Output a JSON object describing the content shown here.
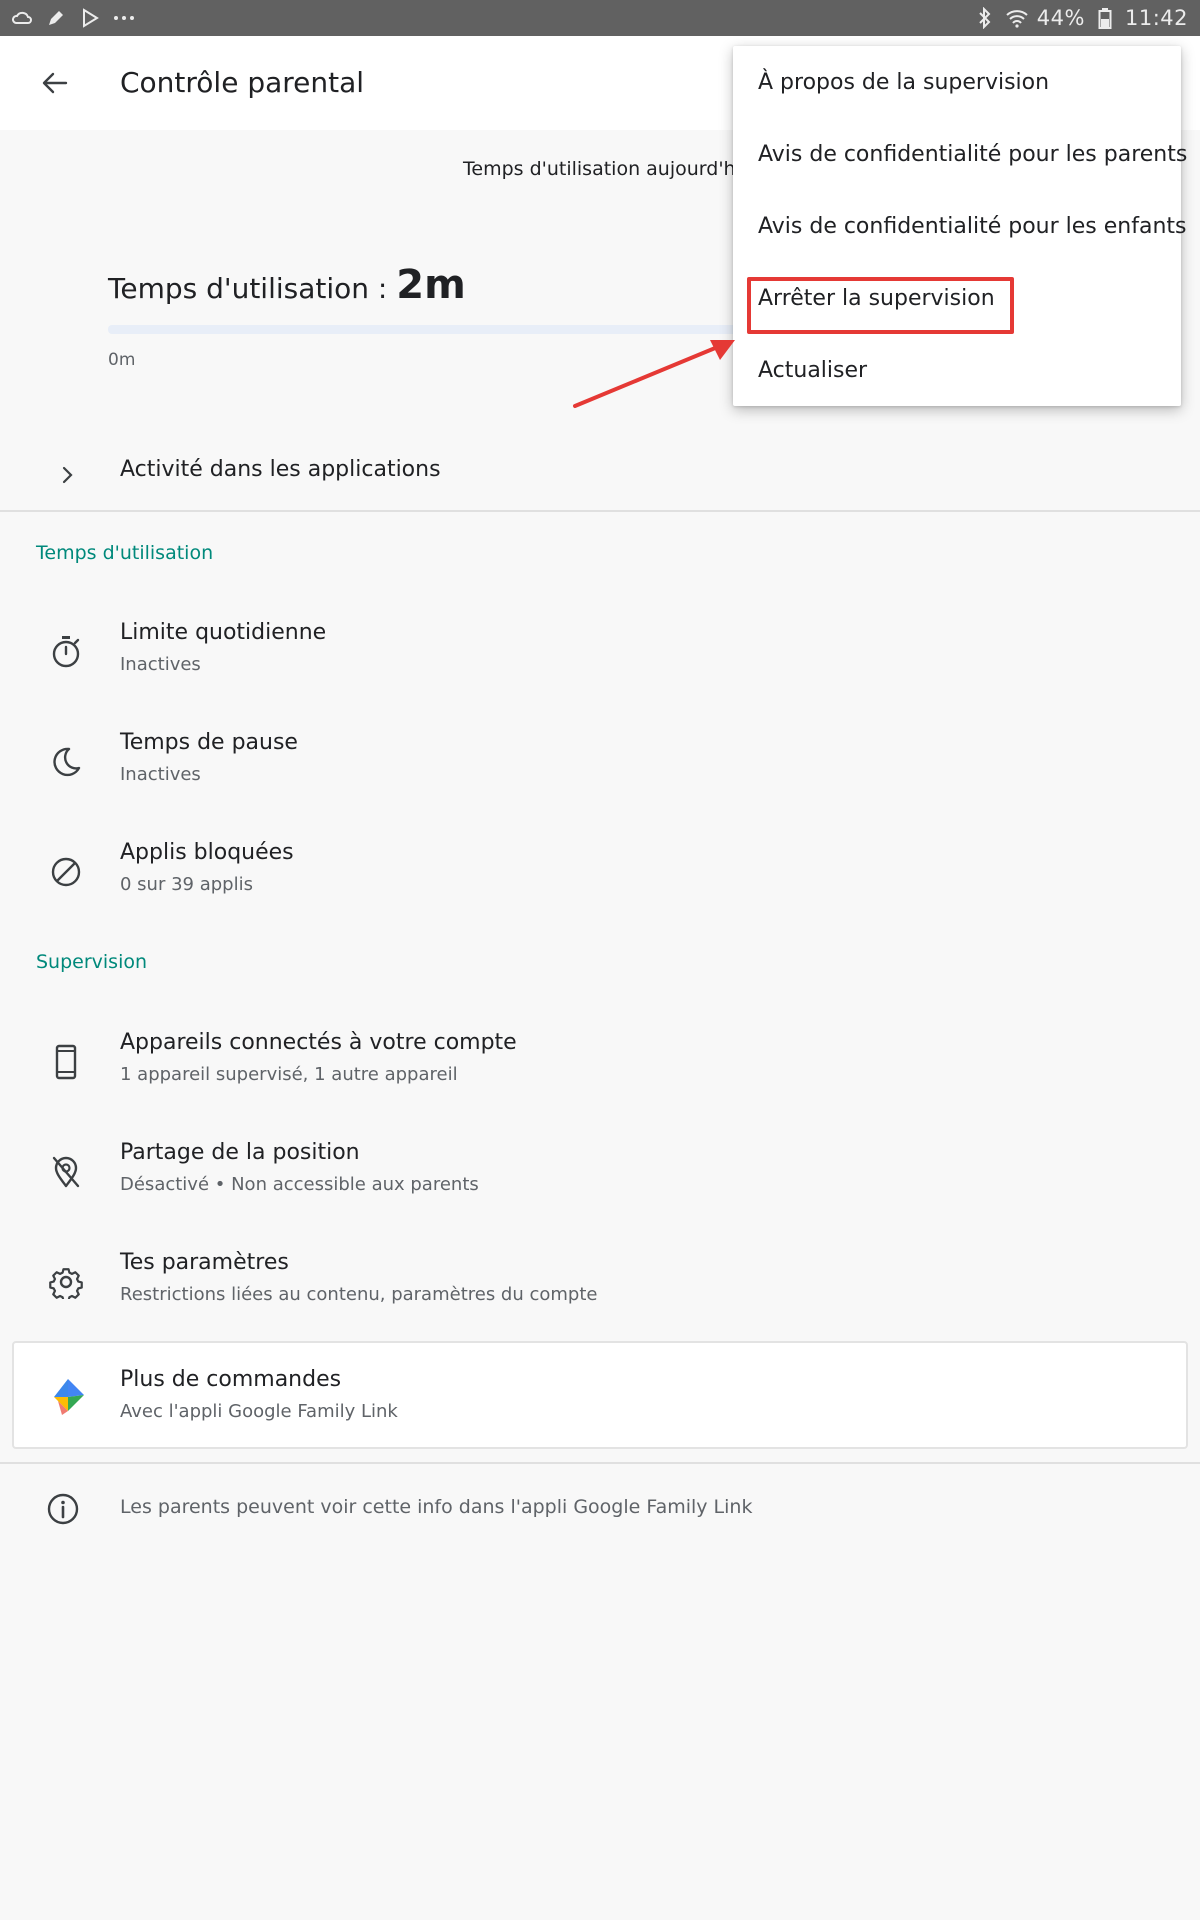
{
  "status_bar": {
    "left_icons": [
      "cloud-icon",
      "pen-icon",
      "play-store-icon",
      "more-dots-icon"
    ],
    "battery_percent": "44%",
    "time": "11:42"
  },
  "app_bar": {
    "title": "Contrôle parental"
  },
  "usage": {
    "caption": "Temps d'utilisation aujourd'hu",
    "heading_label": "Temps d'utilisation : ",
    "heading_value": "2m",
    "axis_start": "0m"
  },
  "activity": {
    "label": "Activité dans les applications"
  },
  "sections": {
    "screen_time": {
      "header": "Temps d'utilisation",
      "items": [
        {
          "title": "Limite quotidienne",
          "subtitle": "Inactives",
          "icon": "timer-icon"
        },
        {
          "title": "Temps de pause",
          "subtitle": "Inactives",
          "icon": "moon-icon"
        },
        {
          "title": "Applis bloquées",
          "subtitle": "0 sur 39 applis",
          "icon": "block-icon"
        }
      ]
    },
    "supervision": {
      "header": "Supervision",
      "items": [
        {
          "title": "Appareils connectés à votre compte",
          "subtitle": "1 appareil supervisé, 1 autre appareil",
          "icon": "phone-icon"
        },
        {
          "title": "Partage de la position",
          "subtitle": "Désactivé • Non accessible aux parents",
          "icon": "location-off-icon"
        },
        {
          "title": "Tes paramètres",
          "subtitle": "Restrictions liées au contenu, paramètres du compte",
          "icon": "gear-icon"
        }
      ]
    }
  },
  "more_controls": {
    "title": "Plus de commandes",
    "subtitle": "Avec l'appli Google Family Link"
  },
  "info": {
    "text": "Les parents peuvent voir cette info dans l'appli Google Family Link"
  },
  "menu": {
    "items": [
      "À propos de la supervision",
      "Avis de confidentialité pour les parents",
      "Avis de confidentialité pour les enfants",
      "Arrêter la supervision",
      "Actualiser"
    ]
  },
  "colors": {
    "accent_teal": "#00897b",
    "annotation_red": "#e53935",
    "status_bar": "#616161"
  }
}
